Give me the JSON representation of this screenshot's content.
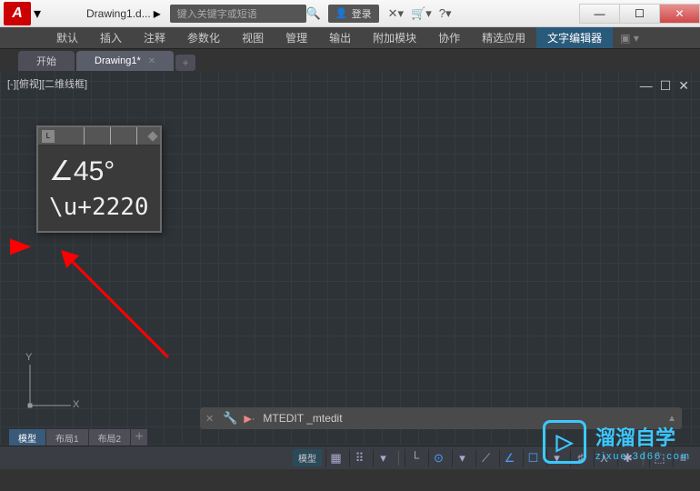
{
  "titlebar": {
    "app_letter": "A",
    "doc_name": "Drawing1.d...",
    "search_placeholder": "键入关键字或短语",
    "login_label": "登录"
  },
  "menubar": {
    "items": [
      "默认",
      "插入",
      "注释",
      "参数化",
      "视图",
      "管理",
      "输出",
      "附加模块",
      "协作",
      "精选应用",
      "文字编辑器"
    ]
  },
  "filetabs": {
    "items": [
      {
        "label": "开始",
        "active": false,
        "closable": false
      },
      {
        "label": "Drawing1*",
        "active": true,
        "closable": true
      }
    ]
  },
  "view": {
    "label": "[-][俯视][二维线框]"
  },
  "text_editor": {
    "ruler_btn": "L",
    "line1": "∠45°",
    "line2": "\\u+2220"
  },
  "ucs": {
    "y": "Y",
    "x": "X"
  },
  "cmd": {
    "text": "MTEDIT _mtedit"
  },
  "layout_tabs": {
    "items": [
      "模型",
      "布局1",
      "布局2"
    ]
  },
  "statusbar": {
    "label": "模型"
  },
  "watermark": {
    "title": "溜溜自学",
    "sub": "zixue.3d66.com"
  }
}
